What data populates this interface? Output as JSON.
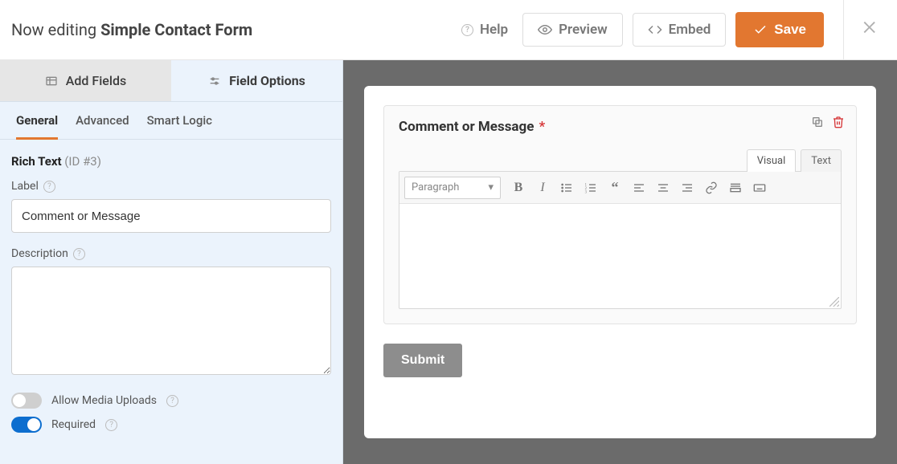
{
  "header": {
    "prefix": "Now editing",
    "formName": "Simple Contact Form",
    "help": "Help",
    "preview": "Preview",
    "embed": "Embed",
    "save": "Save"
  },
  "sidebar": {
    "tabs": {
      "add": "Add Fields",
      "options": "Field Options"
    },
    "subtabs": {
      "general": "General",
      "advanced": "Advanced",
      "smart": "Smart Logic"
    },
    "fieldType": "Rich Text",
    "fieldId": "(ID #3)",
    "labelLabel": "Label",
    "labelValue": "Comment or Message",
    "descLabel": "Description",
    "descValue": "",
    "mediaToggle": "Allow Media Uploads",
    "requiredToggle": "Required"
  },
  "canvas": {
    "fieldLabel": "Comment or Message",
    "visualTab": "Visual",
    "textTab": "Text",
    "formatSelect": "Paragraph",
    "submit": "Submit"
  }
}
